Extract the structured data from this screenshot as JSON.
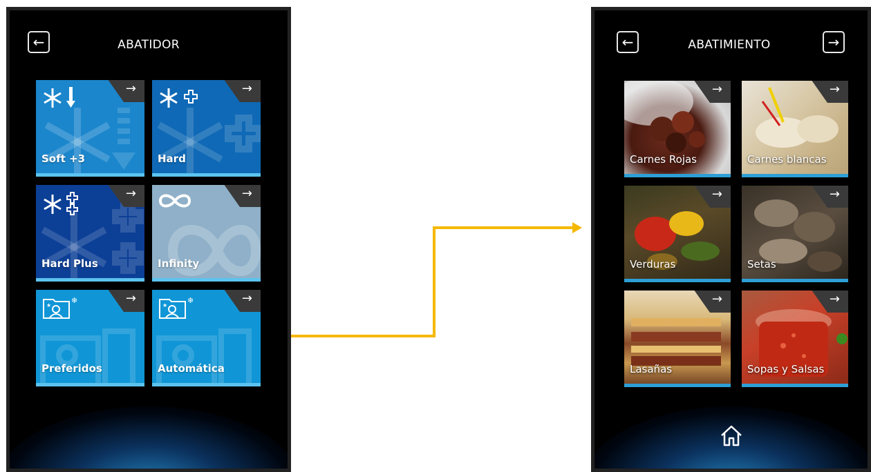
{
  "left_screen": {
    "title": "ABATIDOR",
    "back_glyph": "←",
    "tiles": [
      {
        "label": "Soft +3",
        "icon": "snowflake-down-icon",
        "color": "#1b86cc",
        "arrow": "→"
      },
      {
        "label": "Hard",
        "icon": "snowflake-plus-icon",
        "color": "#0f69b6",
        "arrow": "→"
      },
      {
        "label": "Hard Plus",
        "icon": "snowflake-double-plus-icon",
        "color": "#0c3f96",
        "arrow": "→"
      },
      {
        "label": "Infinity",
        "icon": "infinity-icon",
        "color": "#8fb0c8",
        "arrow": "→"
      },
      {
        "label": "Preferidos",
        "icon": "favorites-folder-icon",
        "color": "#1096d6",
        "arrow": "→"
      },
      {
        "label": "Automática",
        "icon": "auto-folder-icon",
        "color": "#1096d6",
        "arrow": "→"
      }
    ]
  },
  "right_screen": {
    "title": "ABATIMIENTO",
    "back_glyph": "←",
    "forward_glyph": "→",
    "tiles": [
      {
        "label": "Carnes Rojas",
        "image": "red-meat-image",
        "arrow": "→"
      },
      {
        "label": "Carnes blancas",
        "image": "white-meat-image",
        "arrow": "→"
      },
      {
        "label": "Verduras",
        "image": "vegetables-image",
        "arrow": "→"
      },
      {
        "label": "Setas",
        "image": "mushrooms-image",
        "arrow": "→"
      },
      {
        "label": "Lasañas",
        "image": "lasagna-image",
        "arrow": "→"
      },
      {
        "label": "Sopas y Salsas",
        "image": "sauce-image",
        "arrow": "→"
      }
    ],
    "home_icon": "home-icon"
  },
  "connector_color": "#f5b800"
}
